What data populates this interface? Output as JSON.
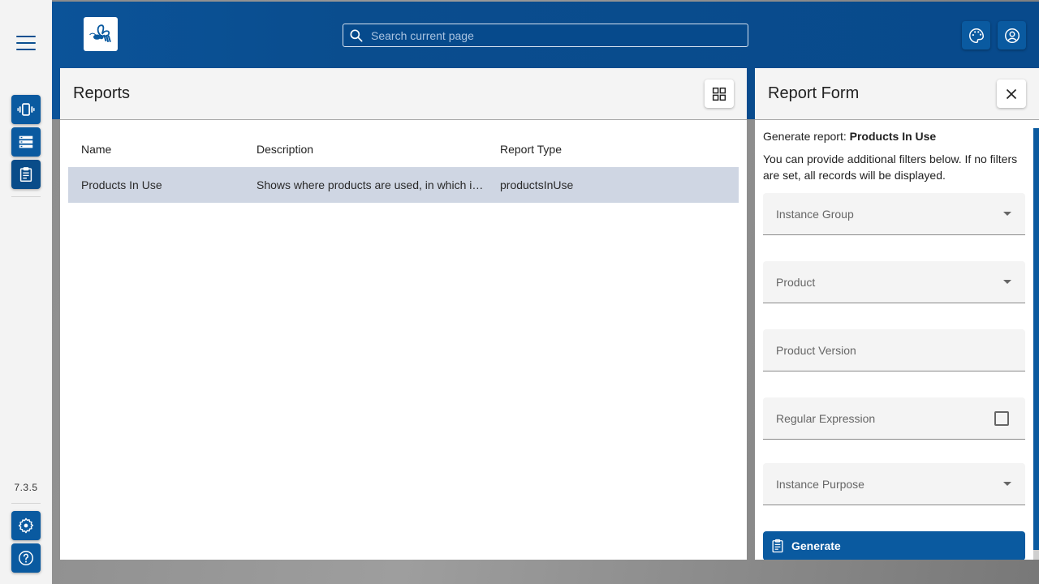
{
  "app": {
    "version": "7.3.5",
    "brand_color": "#0a5aa0"
  },
  "sidebar": {
    "menu_icon": "hamburger-icon",
    "items": [
      {
        "name": "instances",
        "icon": "vibration-device-icon"
      },
      {
        "name": "servers",
        "icon": "server-list-icon"
      },
      {
        "name": "reports",
        "icon": "clipboard-icon",
        "active": true
      }
    ],
    "bottom_items": [
      {
        "name": "settings",
        "icon": "gear-icon"
      },
      {
        "name": "help",
        "icon": "help-circle-icon"
      }
    ]
  },
  "header": {
    "logo_icon": "bee-logo-icon",
    "search": {
      "placeholder": "Search current page",
      "value": ""
    },
    "buttons": [
      {
        "name": "theme",
        "icon": "palette-icon"
      },
      {
        "name": "account",
        "icon": "account-circle-icon"
      }
    ]
  },
  "reports_panel": {
    "title": "Reports",
    "view_toggle_icon": "grid-view-icon",
    "columns": [
      "Name",
      "Description",
      "Report Type"
    ],
    "rows": [
      {
        "name": "Products In Use",
        "description": "Shows where products are used, in which instances and versions.",
        "type": "productsInUse",
        "selected": true
      }
    ]
  },
  "report_form": {
    "title": "Report Form",
    "close_icon": "close-icon",
    "generate_prefix": "Generate report:",
    "report_name": "Products In Use",
    "hint": "You can provide additional filters below. If no filters are set, all records will be displayed.",
    "fields": [
      {
        "label": "Instance Group",
        "type": "select",
        "value": ""
      },
      {
        "label": "Product",
        "type": "select",
        "value": ""
      },
      {
        "label": "Product Version",
        "type": "text",
        "value": ""
      },
      {
        "label": "Regular Expression",
        "type": "checkbox",
        "checked": false
      },
      {
        "label": "Instance Purpose",
        "type": "select",
        "value": ""
      }
    ],
    "generate_label": "Generate"
  }
}
